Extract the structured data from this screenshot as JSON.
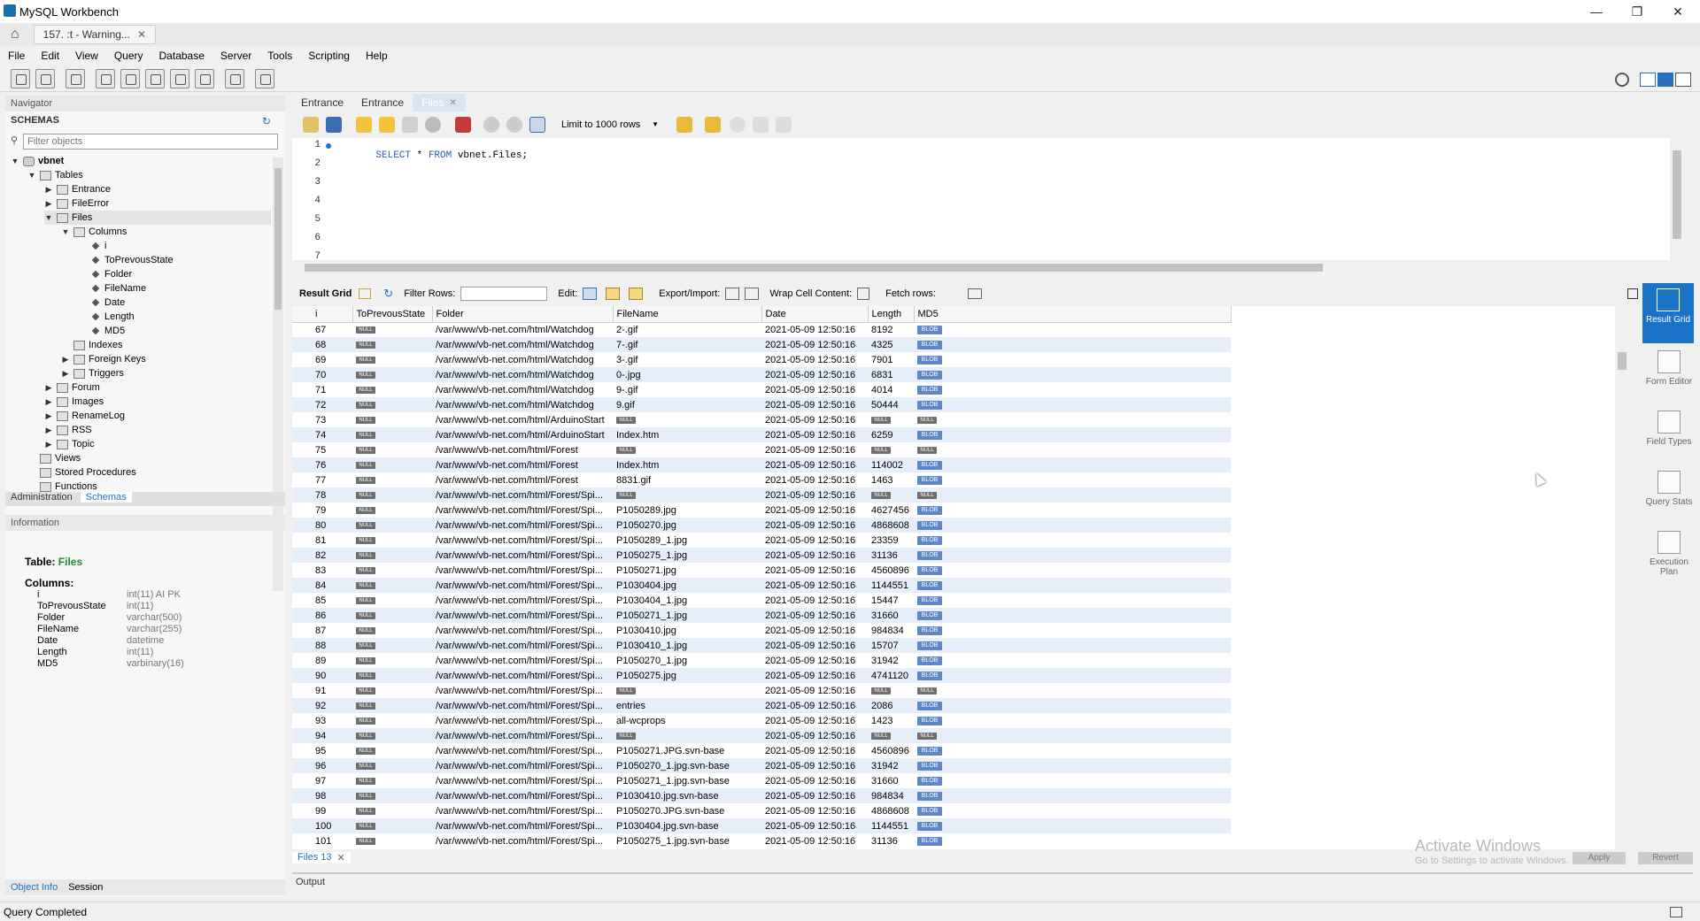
{
  "app": {
    "title": "MySQL Workbench"
  },
  "connection_tab": {
    "label": "157.           :t  - Warning..."
  },
  "menu": [
    "File",
    "Edit",
    "View",
    "Query",
    "Database",
    "Server",
    "Tools",
    "Scripting",
    "Help"
  ],
  "navigator": {
    "header": "Navigator",
    "schemas_label": "SCHEMAS",
    "filter_placeholder": "Filter objects",
    "tree": [
      {
        "label": "vbnet",
        "level": 0,
        "twisty": "▼",
        "icon": "db",
        "bold": true
      },
      {
        "label": "Tables",
        "level": 1,
        "twisty": "▼",
        "icon": "folder"
      },
      {
        "label": "Entrance",
        "level": 2,
        "twisty": "▶",
        "icon": "table"
      },
      {
        "label": "FileError",
        "level": 2,
        "twisty": "▶",
        "icon": "table"
      },
      {
        "label": "Files",
        "level": 2,
        "twisty": "▼",
        "icon": "table",
        "selected": true
      },
      {
        "label": "Columns",
        "level": 3,
        "twisty": "▼",
        "icon": "folder"
      },
      {
        "label": "i",
        "level": 4,
        "twisty": "",
        "icon": "col"
      },
      {
        "label": "ToPrevousState",
        "level": 4,
        "twisty": "",
        "icon": "col"
      },
      {
        "label": "Folder",
        "level": 4,
        "twisty": "",
        "icon": "col"
      },
      {
        "label": "FileName",
        "level": 4,
        "twisty": "",
        "icon": "col"
      },
      {
        "label": "Date",
        "level": 4,
        "twisty": "",
        "icon": "col"
      },
      {
        "label": "Length",
        "level": 4,
        "twisty": "",
        "icon": "col"
      },
      {
        "label": "MD5",
        "level": 4,
        "twisty": "",
        "icon": "col"
      },
      {
        "label": "Indexes",
        "level": 3,
        "twisty": "",
        "icon": "folder"
      },
      {
        "label": "Foreign Keys",
        "level": 3,
        "twisty": "▶",
        "icon": "folder"
      },
      {
        "label": "Triggers",
        "level": 3,
        "twisty": "▶",
        "icon": "folder"
      },
      {
        "label": "Forum",
        "level": 2,
        "twisty": "▶",
        "icon": "table"
      },
      {
        "label": "Images",
        "level": 2,
        "twisty": "▶",
        "icon": "table"
      },
      {
        "label": "RenameLog",
        "level": 2,
        "twisty": "▶",
        "icon": "table"
      },
      {
        "label": "RSS",
        "level": 2,
        "twisty": "▶",
        "icon": "table"
      },
      {
        "label": "Topic",
        "level": 2,
        "twisty": "▶",
        "icon": "table"
      },
      {
        "label": "Views",
        "level": 1,
        "twisty": "",
        "icon": "folder"
      },
      {
        "label": "Stored Procedures",
        "level": 1,
        "twisty": "",
        "icon": "folder"
      },
      {
        "label": "Functions",
        "level": 1,
        "twisty": "",
        "icon": "folder"
      }
    ],
    "tab_admin": "Administration",
    "tab_schemas": "Schemas",
    "info_header": "Information",
    "info_table_label": "Table:",
    "info_table_name": "Files",
    "info_columns_label": "Columns:",
    "info_columns": [
      {
        "name": "i",
        "type": "int(11) AI PK"
      },
      {
        "name": "ToPrevousState",
        "type": "int(11)"
      },
      {
        "name": "Folder",
        "type": "varchar(500)"
      },
      {
        "name": "FileName",
        "type": "varchar(255)"
      },
      {
        "name": "Date",
        "type": "datetime"
      },
      {
        "name": "Length",
        "type": "int(11)"
      },
      {
        "name": "MD5",
        "type": "varbinary(16)"
      }
    ],
    "tab_object_info": "Object Info",
    "tab_session": "Session"
  },
  "sql_tabs": [
    "Entrance",
    "Entrance",
    "Files"
  ],
  "sql_toolbar": {
    "limit": "Limit to 1000 rows"
  },
  "editor": {
    "lines": [
      "1",
      "2",
      "3",
      "4",
      "5",
      "6",
      "7"
    ],
    "kw1": "SELECT",
    "star": " * ",
    "kw2": "FROM",
    "rest": " vbnet.Files;"
  },
  "result_bar": {
    "result_grid": "Result Grid",
    "filter_rows": "Filter Rows:",
    "edit": "Edit:",
    "export_import": "Export/Import:",
    "wrap": "Wrap Cell Content:",
    "fetch": "Fetch rows:"
  },
  "grid": {
    "columns": [
      "i",
      "ToPrevousState",
      "Folder",
      "FileName",
      "Date",
      "Length",
      "MD5"
    ],
    "null_label": "NULL",
    "blob_label": "BLOB",
    "rows": [
      [
        "67",
        "NULL",
        "/var/www/vb-net.com/html/Watchdog",
        "2-.gif",
        "2021-05-09 12:50:16",
        "8192",
        "BLOB"
      ],
      [
        "68",
        "NULL",
        "/var/www/vb-net.com/html/Watchdog",
        "7-.gif",
        "2021-05-09 12:50:16",
        "4325",
        "BLOB"
      ],
      [
        "69",
        "NULL",
        "/var/www/vb-net.com/html/Watchdog",
        "3-.gif",
        "2021-05-09 12:50:16",
        "7901",
        "BLOB"
      ],
      [
        "70",
        "NULL",
        "/var/www/vb-net.com/html/Watchdog",
        "0-.jpg",
        "2021-05-09 12:50:16",
        "6831",
        "BLOB"
      ],
      [
        "71",
        "NULL",
        "/var/www/vb-net.com/html/Watchdog",
        "9-.gif",
        "2021-05-09 12:50:16",
        "4014",
        "BLOB"
      ],
      [
        "72",
        "NULL",
        "/var/www/vb-net.com/html/Watchdog",
        "9.gif",
        "2021-05-09 12:50:16",
        "50444",
        "BLOB"
      ],
      [
        "73",
        "NULL",
        "/var/www/vb-net.com/html/ArduinoStart",
        "NULL",
        "2021-05-09 12:50:16",
        "NULL",
        "NULL"
      ],
      [
        "74",
        "NULL",
        "/var/www/vb-net.com/html/ArduinoStart",
        "Index.htm",
        "2021-05-09 12:50:16",
        "6259",
        "BLOB"
      ],
      [
        "75",
        "NULL",
        "/var/www/vb-net.com/html/Forest",
        "NULL",
        "2021-05-09 12:50:16",
        "NULL",
        "NULL"
      ],
      [
        "76",
        "NULL",
        "/var/www/vb-net.com/html/Forest",
        "Index.htm",
        "2021-05-09 12:50:16",
        "114002",
        "BLOB"
      ],
      [
        "77",
        "NULL",
        "/var/www/vb-net.com/html/Forest",
        "8831.gif",
        "2021-05-09 12:50:16",
        "1463",
        "BLOB"
      ],
      [
        "78",
        "NULL",
        "/var/www/vb-net.com/html/Forest/Spi...",
        "NULL",
        "2021-05-09 12:50:16",
        "NULL",
        "NULL"
      ],
      [
        "79",
        "NULL",
        "/var/www/vb-net.com/html/Forest/Spi...",
        "P1050289.jpg",
        "2021-05-09 12:50:16",
        "4627456",
        "BLOB"
      ],
      [
        "80",
        "NULL",
        "/var/www/vb-net.com/html/Forest/Spi...",
        "P1050270.jpg",
        "2021-05-09 12:50:16",
        "4868608",
        "BLOB"
      ],
      [
        "81",
        "NULL",
        "/var/www/vb-net.com/html/Forest/Spi...",
        "P1050289_1.jpg",
        "2021-05-09 12:50:16",
        "23359",
        "BLOB"
      ],
      [
        "82",
        "NULL",
        "/var/www/vb-net.com/html/Forest/Spi...",
        "P1050275_1.jpg",
        "2021-05-09 12:50:16",
        "31136",
        "BLOB"
      ],
      [
        "83",
        "NULL",
        "/var/www/vb-net.com/html/Forest/Spi...",
        "P1050271.jpg",
        "2021-05-09 12:50:16",
        "4560896",
        "BLOB"
      ],
      [
        "84",
        "NULL",
        "/var/www/vb-net.com/html/Forest/Spi...",
        "P1030404.jpg",
        "2021-05-09 12:50:16",
        "1144551",
        "BLOB"
      ],
      [
        "85",
        "NULL",
        "/var/www/vb-net.com/html/Forest/Spi...",
        "P1030404_1.jpg",
        "2021-05-09 12:50:16",
        "15447",
        "BLOB"
      ],
      [
        "86",
        "NULL",
        "/var/www/vb-net.com/html/Forest/Spi...",
        "P1050271_1.jpg",
        "2021-05-09 12:50:16",
        "31660",
        "BLOB"
      ],
      [
        "87",
        "NULL",
        "/var/www/vb-net.com/html/Forest/Spi...",
        "P1030410.jpg",
        "2021-05-09 12:50:16",
        "984834",
        "BLOB"
      ],
      [
        "88",
        "NULL",
        "/var/www/vb-net.com/html/Forest/Spi...",
        "P1030410_1.jpg",
        "2021-05-09 12:50:16",
        "15707",
        "BLOB"
      ],
      [
        "89",
        "NULL",
        "/var/www/vb-net.com/html/Forest/Spi...",
        "P1050270_1.jpg",
        "2021-05-09 12:50:16",
        "31942",
        "BLOB"
      ],
      [
        "90",
        "NULL",
        "/var/www/vb-net.com/html/Forest/Spi...",
        "P1050275.jpg",
        "2021-05-09 12:50:16",
        "4741120",
        "BLOB"
      ],
      [
        "91",
        "NULL",
        "/var/www/vb-net.com/html/Forest/Spi...",
        "NULL",
        "2021-05-09 12:50:16",
        "NULL",
        "NULL"
      ],
      [
        "92",
        "NULL",
        "/var/www/vb-net.com/html/Forest/Spi...",
        "entries",
        "2021-05-09 12:50:16",
        "2086",
        "BLOB"
      ],
      [
        "93",
        "NULL",
        "/var/www/vb-net.com/html/Forest/Spi...",
        "all-wcprops",
        "2021-05-09 12:50:16",
        "1423",
        "BLOB"
      ],
      [
        "94",
        "NULL",
        "/var/www/vb-net.com/html/Forest/Spi...",
        "NULL",
        "2021-05-09 12:50:16",
        "NULL",
        "NULL"
      ],
      [
        "95",
        "NULL",
        "/var/www/vb-net.com/html/Forest/Spi...",
        "P1050271.JPG.svn-base",
        "2021-05-09 12:50:16",
        "4560896",
        "BLOB"
      ],
      [
        "96",
        "NULL",
        "/var/www/vb-net.com/html/Forest/Spi...",
        "P1050270_1.jpg.svn-base",
        "2021-05-09 12:50:16",
        "31942",
        "BLOB"
      ],
      [
        "97",
        "NULL",
        "/var/www/vb-net.com/html/Forest/Spi...",
        "P1050271_1.jpg.svn-base",
        "2021-05-09 12:50:16",
        "31660",
        "BLOB"
      ],
      [
        "98",
        "NULL",
        "/var/www/vb-net.com/html/Forest/Spi...",
        "P1030410.jpg.svn-base",
        "2021-05-09 12:50:16",
        "984834",
        "BLOB"
      ],
      [
        "99",
        "NULL",
        "/var/www/vb-net.com/html/Forest/Spi...",
        "P1050270.JPG.svn-base",
        "2021-05-09 12:50:16",
        "4868608",
        "BLOB"
      ],
      [
        "100",
        "NULL",
        "/var/www/vb-net.com/html/Forest/Spi...",
        "P1030404.jpg.svn-base",
        "2021-05-09 12:50:16",
        "1144551",
        "BLOB"
      ],
      [
        "101",
        "NULL",
        "/var/www/vb-net.com/html/Forest/Spi...",
        "P1050275_1.jpg.svn-base",
        "2021-05-09 12:50:16",
        "31136",
        "BLOB"
      ]
    ]
  },
  "side_panel": [
    "Result Grid",
    "Form Editor",
    "Field Types",
    "Query Stats",
    "Execution Plan"
  ],
  "bottom": {
    "result_tab": "Files 13",
    "output": "Output",
    "apply": "Apply",
    "revert": "Revert",
    "watermark": "Activate Windows",
    "watermark_sub": "Go to Settings to activate Windows."
  },
  "status": "Query Completed",
  "colors": {
    "accent": "#1a73c7",
    "sql_keyword": "#2a5fb0",
    "table_name_green": "#1e8c2e",
    "row_alt": "#e6eefa"
  }
}
